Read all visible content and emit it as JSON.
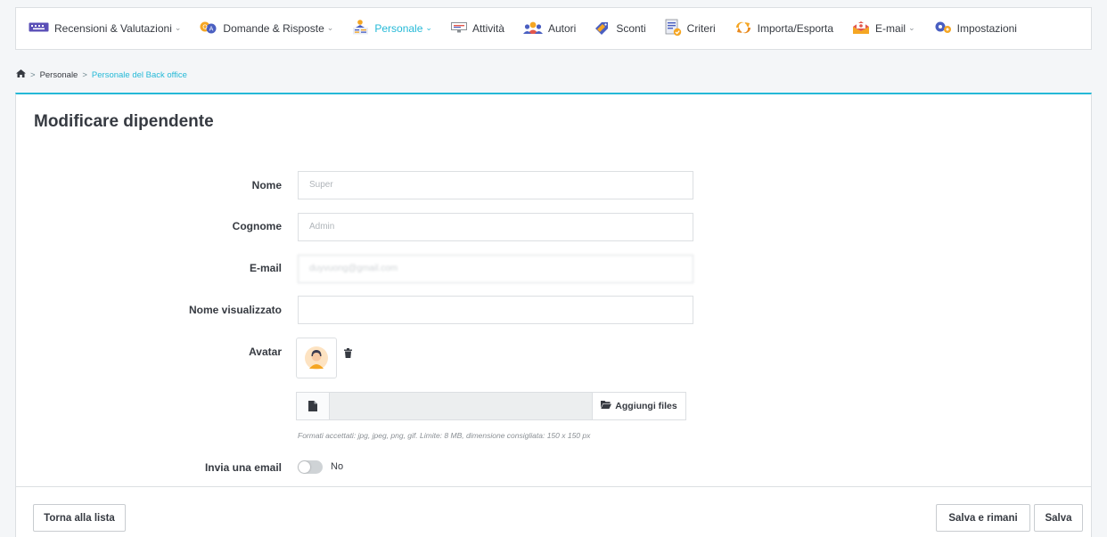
{
  "nav": {
    "items": [
      {
        "label": "Recensioni & Valutazioni",
        "icon": "keyboard-icon",
        "dropdown": true,
        "active": false
      },
      {
        "label": "Domande & Risposte",
        "icon": "question-answer-icon",
        "dropdown": true,
        "active": false
      },
      {
        "label": "Personale",
        "icon": "staff-icon",
        "dropdown": true,
        "active": true
      },
      {
        "label": "Attività",
        "icon": "activity-icon",
        "dropdown": false,
        "active": false
      },
      {
        "label": "Autori",
        "icon": "authors-icon",
        "dropdown": false,
        "active": false
      },
      {
        "label": "Sconti",
        "icon": "discount-tag-icon",
        "dropdown": false,
        "active": false
      },
      {
        "label": "Criteri",
        "icon": "criteria-icon",
        "dropdown": false,
        "active": false
      },
      {
        "label": "Importa/Esporta",
        "icon": "import-export-icon",
        "dropdown": false,
        "active": false
      },
      {
        "label": "E-mail",
        "icon": "email-icon",
        "dropdown": true,
        "active": false
      },
      {
        "label": "Impostazioni",
        "icon": "settings-icon",
        "dropdown": false,
        "active": false
      }
    ]
  },
  "breadcrumb": {
    "sep": ">",
    "level1": "Personale",
    "current": "Personale del Back office"
  },
  "page": {
    "title": "Modificare dipendente"
  },
  "form": {
    "first_name": {
      "label": "Nome",
      "value": "Super"
    },
    "last_name": {
      "label": "Cognome",
      "value": "Admin"
    },
    "email": {
      "label": "E-mail",
      "value": "duyvuong@gmail.com"
    },
    "display_name": {
      "label": "Nome visualizzato",
      "value": ""
    },
    "avatar": {
      "label": "Avatar"
    },
    "file_button": "Aggiungi files",
    "file_help": "Formati accettati: jpg, jpeg, png, gif. Limite: 8 MB, dimensione consigliata: 150 x 150 px",
    "send_email": {
      "label": "Invia una email",
      "state": "No"
    }
  },
  "footer": {
    "back": "Torna alla lista",
    "save_stay": "Salva e rimani",
    "save": "Salva"
  },
  "colors": {
    "accent": "#25b9d7",
    "text": "#363a41",
    "border": "#dcdfe2"
  }
}
